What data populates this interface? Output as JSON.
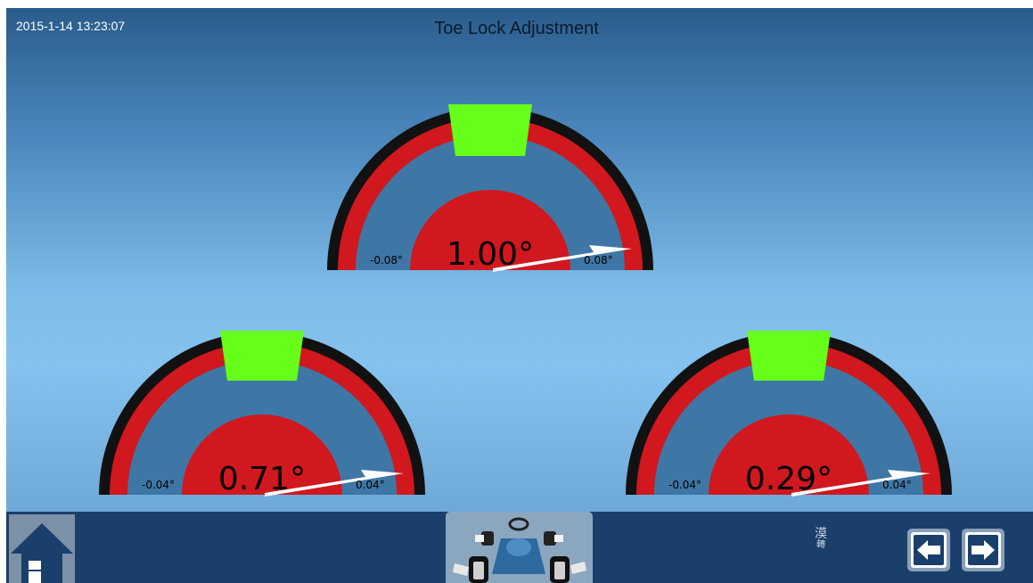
{
  "header": {
    "datetime": "2015-1-14 13:23:07",
    "title": "Toe Lock Adjustment"
  },
  "gauges": [
    {
      "id": "total",
      "value": "1.00°",
      "min_label": "-0.08°",
      "max_label": "0.08°"
    },
    {
      "id": "left",
      "value": "0.71°",
      "min_label": "-0.04°",
      "max_label": "0.04°"
    },
    {
      "id": "right",
      "value": "0.29°",
      "min_label": "-0.04°",
      "max_label": "0.04°"
    }
  ],
  "bottom_bar": {
    "side_text_top": "漠",
    "side_text_bottom": "轉",
    "icons": {
      "home": "home-icon",
      "car": "car-steering-icon",
      "prev": "arrow-left-icon",
      "next": "arrow-right-icon"
    }
  },
  "colors": {
    "arc_outer": "#111111",
    "arc_red": "#d0181e",
    "tolerance_green": "#66ff1a",
    "needle": "#ffffff",
    "bar_bg": "#1b3f6b"
  }
}
